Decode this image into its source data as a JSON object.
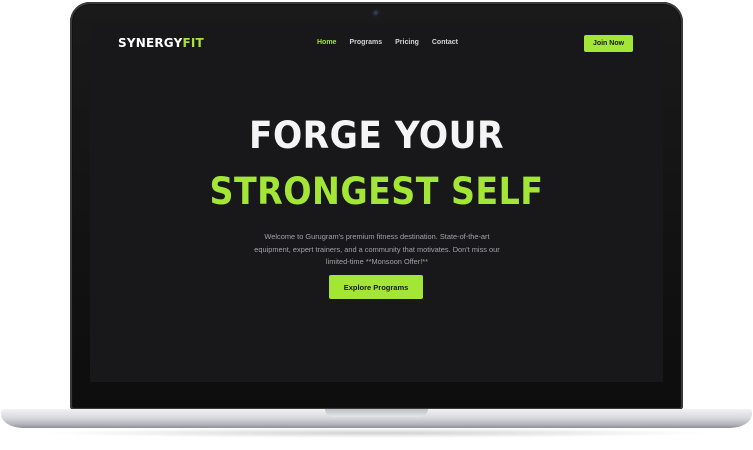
{
  "site": {
    "logo": {
      "part1": "SYNERGY",
      "part2": "FIT"
    },
    "nav": {
      "items": [
        {
          "label": "Home",
          "active": true
        },
        {
          "label": "Programs",
          "active": false
        },
        {
          "label": "Pricing",
          "active": false
        },
        {
          "label": "Contact",
          "active": false
        }
      ],
      "cta_label": "Join Now"
    },
    "hero": {
      "title_line1": "FORGE YOUR",
      "title_line2": "STRONGEST SELF",
      "description": "Welcome to Gurugram's premium fitness destination. State-of-the-art equipment, expert trainers, and a community that motivates. Don't miss our limited-time **Monsoon Offer!**",
      "button_label": "Explore Programs"
    },
    "colors": {
      "accent": "#a3e635",
      "background": "#18181b",
      "text": "#f4f4f5",
      "muted": "#a1a1aa"
    }
  }
}
